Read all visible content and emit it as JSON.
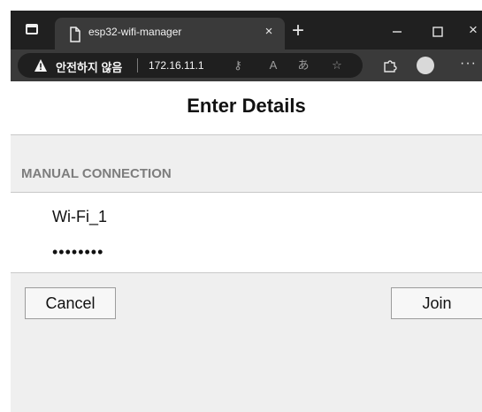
{
  "browser": {
    "tab_title": "esp32-wifi-manager",
    "tab_close": "×",
    "new_tab": "+",
    "security_label": "안전하지 않음",
    "url": "172.16.11.1",
    "window_close": "×",
    "more_menu": "···"
  },
  "page": {
    "title": "Enter Details",
    "section_title": "MANUAL CONNECTION",
    "ssid_value": "Wi-Fi_1",
    "password_value": "••••••••",
    "cancel_label": "Cancel",
    "join_label": "Join"
  },
  "icons": {
    "window_menu": "window-menu-icon",
    "page": "page-icon",
    "warning": "warning-icon",
    "key": "key-icon",
    "read_aloud": "read-aloud-icon",
    "translate": "translate-icon",
    "favorite": "favorite-icon",
    "extensions": "extensions-icon",
    "profile": "profile-icon"
  }
}
